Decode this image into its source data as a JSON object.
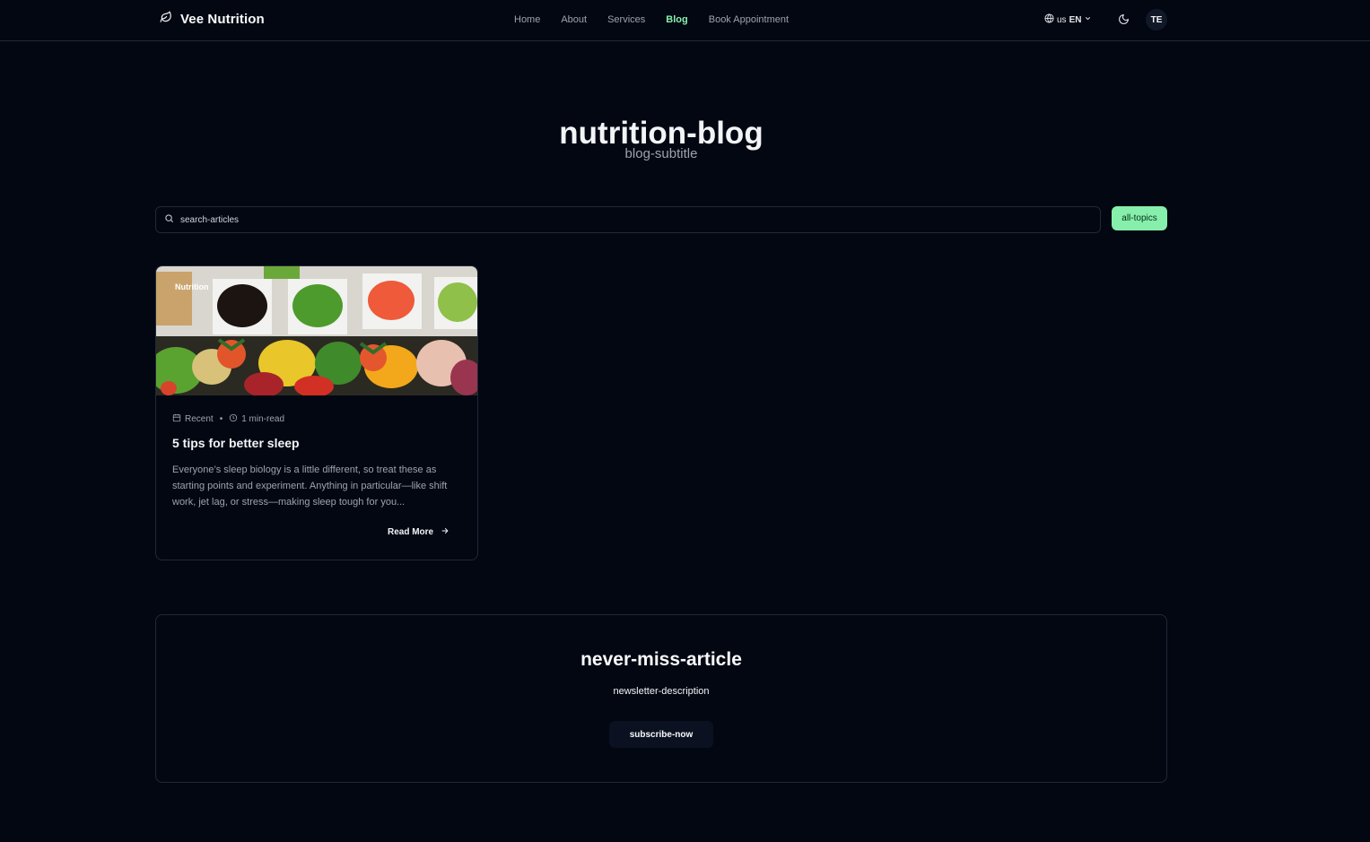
{
  "header": {
    "brand": "Vee Nutrition",
    "nav": [
      "Home",
      "About",
      "Services",
      "Blog",
      "Book Appointment"
    ],
    "active_nav": "Blog",
    "lang_flag": "us",
    "lang_code": "EN",
    "avatar_initials": "TE"
  },
  "hero": {
    "title": "nutrition-blog",
    "subtitle": "blog-subtitle"
  },
  "filters": {
    "search_placeholder": "search-articles",
    "topics_label": "all-topics"
  },
  "articles": [
    {
      "tag": "Nutrition",
      "date": "Recent",
      "read_time": "1 min-read",
      "title": "5 tips for better sleep",
      "excerpt": "Everyone’s sleep biology is a little different, so treat these as starting points and experiment. Anything in particular—like shift work, jet lag, or stress—making sleep tough for you...",
      "read_more": "Read More"
    }
  ],
  "newsletter": {
    "title": "never-miss-article",
    "description": "newsletter-description",
    "button": "subscribe-now"
  },
  "colors": {
    "background": "#030712",
    "accent": "#86efac",
    "border": "#1f2937",
    "muted_text": "#9ca3af"
  },
  "icons": {
    "brand": "leaf-icon",
    "language": "globe-icon",
    "theme": "moon-icon",
    "search": "search-icon",
    "date": "calendar-icon",
    "time": "clock-icon",
    "read_more": "arrow-right-icon"
  }
}
